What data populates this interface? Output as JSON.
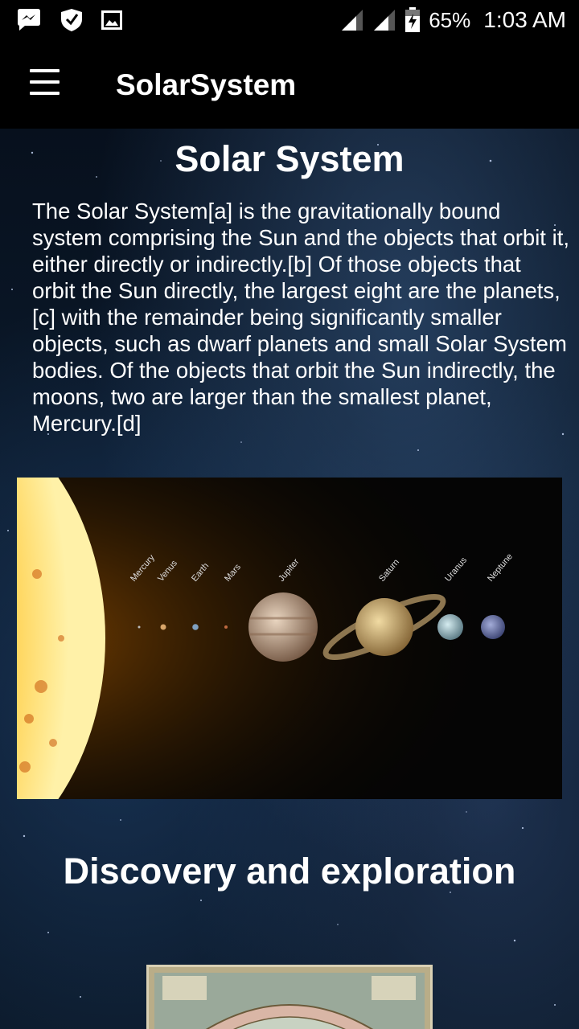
{
  "status_bar": {
    "battery": "65%",
    "time": "1:03 AM",
    "icons": [
      "messenger-icon",
      "shield-icon",
      "image-icon",
      "signal-icon",
      "signal-icon",
      "battery-charging-icon"
    ]
  },
  "app_bar": {
    "title": "SolarSystem",
    "menu_icon": "hamburger-menu-icon"
  },
  "article": {
    "heading": "Solar System",
    "paragraph": "The Solar System[a] is the gravitationally bound system comprising the Sun and the objects that orbit it, either directly or indirectly.[b] Of those objects that orbit the Sun directly, the largest eight are the planets,[c] with the remainder being significantly smaller objects, such as dwarf planets and small Solar System bodies. Of the objects that orbit the Sun indirectly, the moons, two are larger than the smallest planet, Mercury.[d]",
    "image_planet_labels": [
      "Mercury",
      "Venus",
      "Earth",
      "Mars",
      "Jupiter",
      "Saturn",
      "Uranus",
      "Neptune"
    ],
    "section_heading": "Discovery and exploration"
  },
  "colors": {
    "background": "#000000",
    "sun": "#f5a00a",
    "text": "#ffffff"
  }
}
